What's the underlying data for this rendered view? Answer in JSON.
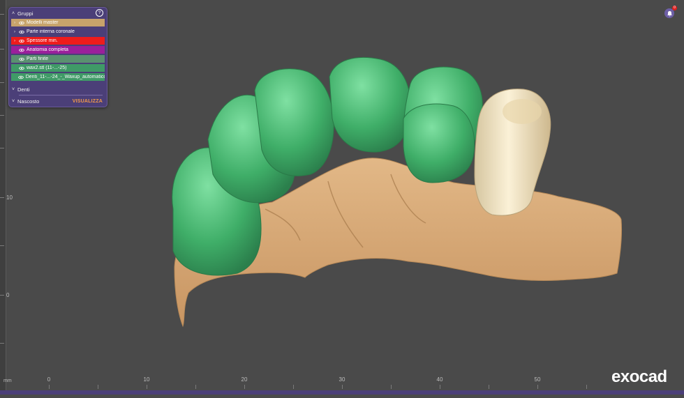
{
  "panel": {
    "title": "Gruppi",
    "items": [
      {
        "label": "Modelli master",
        "color": "#c7a36b",
        "expand": "›"
      },
      {
        "label": "Parte interna coronale",
        "color": "#4b3f78",
        "expand": "›"
      },
      {
        "label": "Spessore min.",
        "color": "#ee1c1c",
        "expand": "›"
      },
      {
        "label": "Anatomia completa",
        "color": "#9b1f9b",
        "expand": ""
      },
      {
        "label": "Parti finite",
        "color": "#5a9070",
        "expand": ""
      },
      {
        "label": "wax2.stl (11-...-25)",
        "color": "#3f9a67",
        "expand": ""
      },
      {
        "label": "Denti_11-...-24_-_Waxup_automatico...",
        "color": "#3f9a67",
        "expand": ""
      }
    ],
    "sections": {
      "denti": "Denti",
      "nascosto": "Nascosto",
      "visualizza": "VISUALIZZA"
    }
  },
  "ruler": {
    "unit": "mm",
    "x_labels": [
      "0",
      "10",
      "20",
      "30",
      "40",
      "50"
    ],
    "y_labels": [
      "10",
      "0"
    ]
  },
  "brand": {
    "logo": "exocad"
  },
  "notifications": {
    "count": "0"
  }
}
